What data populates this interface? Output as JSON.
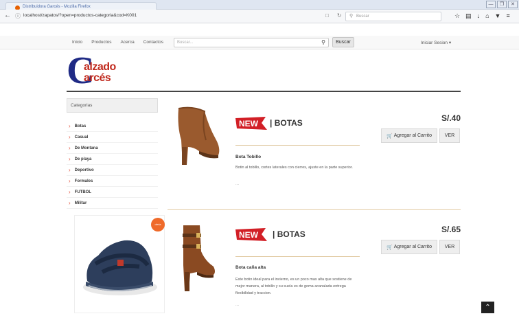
{
  "browser": {
    "window_title": "Distribuidora Garcés - Mozilla Firefox",
    "url": "localhost/zapatos/?open=productos-categoria&cod=K001",
    "search_placeholder": "Buscar",
    "window_buttons": [
      "—",
      "❐",
      "✕"
    ]
  },
  "site": {
    "nav_links": [
      "Inicio",
      "Productos",
      "Acerca",
      "Contactos"
    ],
    "search_placeholder": "Buscar...",
    "search_button": "Buscar",
    "login_label": "Iniciar Sesion ▾"
  },
  "logo": {
    "big_letter": "C",
    "line1": "alzado",
    "line2": "arcés"
  },
  "sidebar": {
    "title": "Categorias",
    "categories": [
      "Botas",
      "Casual",
      "De Montana",
      "De playa",
      "Deportivo",
      "Formales",
      "FUTBOL",
      "Militar"
    ]
  },
  "promo": {
    "badge": "oferta"
  },
  "products": [
    {
      "new_label": "NEW",
      "category": "| BOTAS",
      "name": "Bota Tobillo",
      "description": "Botin al tobillo, cortes laterales con cierres, ajuste en la parte superior.",
      "dots": "...",
      "price": "S/.40",
      "cart_label": "Agregar al Carrito",
      "view_label": "VER"
    },
    {
      "new_label": "NEW",
      "category": "| BOTAS",
      "name": "Bota caña alta",
      "description": "Este botin ideal para el invierno, es un poco mas alta que sostiene de mejor manera, al tobillo y su suela es de goma acanalada entrega flexibilidad y traccion.",
      "dots": "...",
      "price": "S/.65",
      "cart_label": "Agregar al Carrito",
      "view_label": "VER"
    }
  ],
  "colors": {
    "new_red": "#d21f26",
    "logo_blue": "#1f2a85",
    "logo_red": "#c0281c",
    "chevron": "#e2533d"
  }
}
